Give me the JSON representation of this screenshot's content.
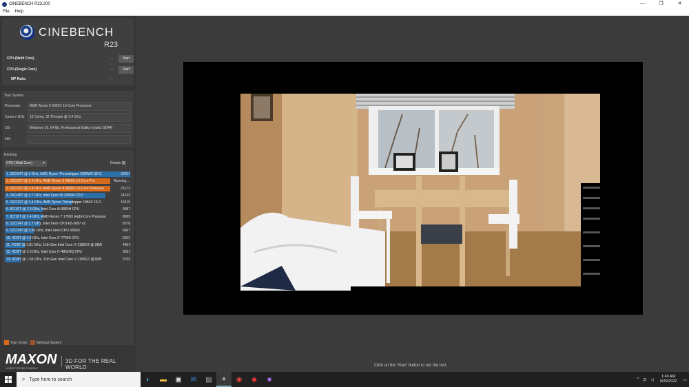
{
  "window": {
    "title": "CINEBENCH R23.200",
    "minimize": "—",
    "maximize": "❐",
    "close": "✕"
  },
  "menu": [
    "File",
    "Help"
  ],
  "logo": {
    "name": "CINEBENCH",
    "version": "R23"
  },
  "benchmarks": [
    {
      "label": "CPU (Multi Core)",
      "value": "---",
      "button": "Start"
    },
    {
      "label": "CPU (Single Core)",
      "value": "---",
      "button": "Start"
    },
    {
      "label": "MP Ratio",
      "value": "---"
    }
  ],
  "your_system": {
    "heading": "Your System",
    "rows": [
      {
        "key": "Processor",
        "value": "AMD Ryzen 9 5950X 16-Core Processor"
      },
      {
        "key": "Cores x GHz",
        "value": "16 Cores, 32 Threads @ 3.4 GHz"
      },
      {
        "key": "OS",
        "value": "Windows 10, 64 Bit, Professional Edition (build 19044)"
      },
      {
        "key": "Info",
        "value": ""
      }
    ]
  },
  "ranking": {
    "heading": "Ranking",
    "dropdown": "CPU (Multi Core)",
    "details": "Details",
    "items": [
      {
        "text": "1. 32C/64T @ 3 GHz, AMD Ryzen Threadripper 2990WX 32-C",
        "score": "30054",
        "fill": 1.0,
        "kind": "blue"
      },
      {
        "text": "2. 16C/32T @ 3.4 GHz, AMD Ryzen 9 5950X 16-Core Pro",
        "score": "Running ...",
        "fill": 0.84,
        "kind": "current"
      },
      {
        "text": "3. 16C/32T @ 3.4 GHz, AMD Ryzen 9 5950X 16-Core Processo",
        "score": "25173",
        "fill": 0.84,
        "kind": "orange"
      },
      {
        "text": "4. 24C/48T @ 2.7 GHz, Intel Xeon W-3265M CPU",
        "score": "24243",
        "fill": 0.8,
        "kind": "blue"
      },
      {
        "text": "5. 16C/32T @ 3.4 GHz, AMD Ryzen Threadripper 1950X 16-C",
        "score": "16315",
        "fill": 0.54,
        "kind": "blue"
      },
      {
        "text": "6. 8C/16T @ 2.3 GHz, Intel Core i9-9880H CPU",
        "score": "9087",
        "fill": 0.3,
        "kind": "blue"
      },
      {
        "text": "7. 8C/16T @ 3.4 GHz, AMD Ryzen 7 1700X Eight-Core Processo",
        "score": "8889",
        "fill": 0.3,
        "kind": "blue"
      },
      {
        "text": "8. 12C/24T @ 2.7 GHz, Intel Xeon CPU E5-2697 v2",
        "score": "8378",
        "fill": 0.28,
        "kind": "blue"
      },
      {
        "text": "9. 12C/24T @ 2.66 GHz, Intel Xeon CPU X5650",
        "score": "6867",
        "fill": 0.23,
        "kind": "blue"
      },
      {
        "text": "10. 4C/8T @ 4.2 GHz, Intel Core i7-7700K CPU",
        "score": "6302",
        "fill": 0.21,
        "kind": "blue"
      },
      {
        "text": "11. 4C/8T @ 2.81 GHz, 11th Gen Intel Core i7-1165G7 @ 28W",
        "score": "4904",
        "fill": 0.16,
        "kind": "blue"
      },
      {
        "text": "12. 4C/8T @ 2.3 GHz, Intel Core i7-4850HQ CPU",
        "score": "3891",
        "fill": 0.13,
        "kind": "blue"
      },
      {
        "text": "13. 4C/8T @ 1.69 GHz, 11th Gen Intel Core i7-1165G7 @15W",
        "score": "3769",
        "fill": 0.125,
        "kind": "blue"
      }
    ]
  },
  "legend": {
    "your_score": "Your Score",
    "identical": "Identical System",
    "your_color": "#d86a1c",
    "identical_color": "#a0522d"
  },
  "brand": {
    "name": "MAXON",
    "sub": "A NEMETSCHEK COMPANY",
    "tagline": "3D FOR THE REAL WORLD"
  },
  "footer": "Click on the 'Start' button to run the test.",
  "taskbar": {
    "search_placeholder": "Type here to search",
    "time": "1:49 AM",
    "date": "9/20/2022"
  }
}
